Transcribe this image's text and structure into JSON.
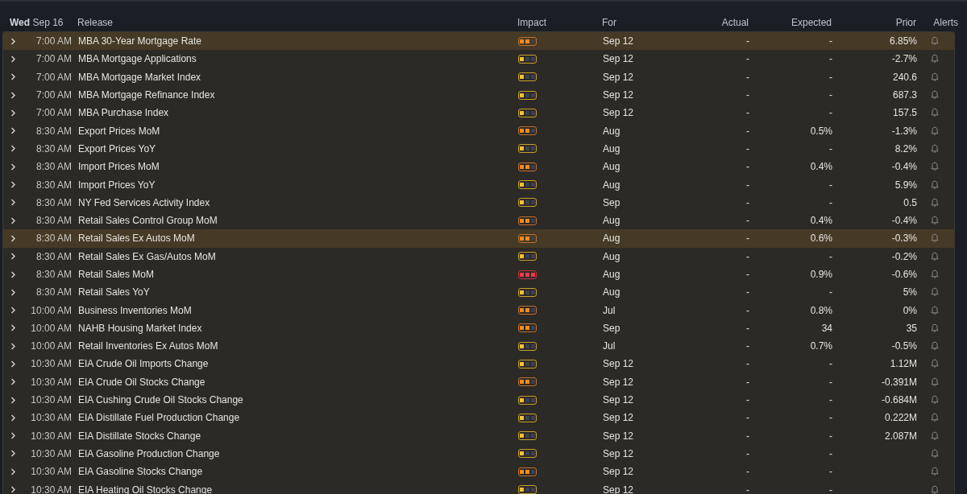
{
  "header": {
    "day": "Wed",
    "date": "Sep 16",
    "columns": [
      "Release",
      "Impact",
      "For",
      "Actual",
      "Expected",
      "Prior",
      "Alerts"
    ]
  },
  "rows": [
    {
      "time": "7:00 AM",
      "release": "MBA 30-Year Mortgage Rate",
      "impact": {
        "level": 0.667
      },
      "for": "Sep 12",
      "actual": "-",
      "expected": "-",
      "prior": "6.85%",
      "highlighted": true
    },
    {
      "time": "7:00 AM",
      "release": "MBA Mortgage Applications",
      "impact": {
        "level": 0.333
      },
      "for": "Sep 12",
      "actual": "-",
      "expected": "-",
      "prior": "-2.7%",
      "highlighted": false
    },
    {
      "time": "7:00 AM",
      "release": "MBA Mortgage Market Index",
      "impact": {
        "level": 0.333
      },
      "for": "Sep 12",
      "actual": "-",
      "expected": "-",
      "prior": "240.6",
      "highlighted": false
    },
    {
      "time": "7:00 AM",
      "release": "MBA Mortgage Refinance Index",
      "impact": {
        "level": 0.333
      },
      "for": "Sep 12",
      "actual": "-",
      "expected": "-",
      "prior": "687.3",
      "highlighted": false
    },
    {
      "time": "7:00 AM",
      "release": "MBA Purchase Index",
      "impact": {
        "level": 0.333
      },
      "for": "Sep 12",
      "actual": "-",
      "expected": "-",
      "prior": "157.5",
      "highlighted": false
    },
    {
      "time": "8:30 AM",
      "release": "Export Prices MoM",
      "impact": {
        "level": 0.667
      },
      "for": "Aug",
      "actual": "-",
      "expected": "0.5%",
      "prior": "-1.3%",
      "highlighted": false
    },
    {
      "time": "8:30 AM",
      "release": "Export Prices YoY",
      "impact": {
        "level": 0.333
      },
      "for": "Aug",
      "actual": "-",
      "expected": "-",
      "prior": "8.2%",
      "highlighted": false
    },
    {
      "time": "8:30 AM",
      "release": "Import Prices MoM",
      "impact": {
        "level": 0.667
      },
      "for": "Aug",
      "actual": "-",
      "expected": "0.4%",
      "prior": "-0.4%",
      "highlighted": false
    },
    {
      "time": "8:30 AM",
      "release": "Import Prices YoY",
      "impact": {
        "level": 0.333
      },
      "for": "Aug",
      "actual": "-",
      "expected": "-",
      "prior": "5.9%",
      "highlighted": false
    },
    {
      "time": "8:30 AM",
      "release": "NY Fed Services Activity Index",
      "impact": {
        "level": 0.333
      },
      "for": "Sep",
      "actual": "-",
      "expected": "-",
      "prior": "0.5",
      "highlighted": false
    },
    {
      "time": "8:30 AM",
      "release": "Retail Sales Control Group MoM",
      "impact": {
        "level": 0.667
      },
      "for": "Aug",
      "actual": "-",
      "expected": "0.4%",
      "prior": "-0.4%",
      "highlighted": false
    },
    {
      "time": "8:30 AM",
      "release": "Retail Sales Ex Autos MoM",
      "impact": {
        "level": 0.667
      },
      "for": "Aug",
      "actual": "-",
      "expected": "0.6%",
      "prior": "-0.3%",
      "highlighted": true
    },
    {
      "time": "8:30 AM",
      "release": "Retail Sales Ex Gas/Autos MoM",
      "impact": {
        "level": 0.333
      },
      "for": "Aug",
      "actual": "-",
      "expected": "-",
      "prior": "-0.2%",
      "highlighted": false
    },
    {
      "time": "8:30 AM",
      "release": "Retail Sales MoM",
      "impact": {
        "level": 1
      },
      "for": "Aug",
      "actual": "-",
      "expected": "0.9%",
      "prior": "-0.6%",
      "highlighted": false
    },
    {
      "time": "8:30 AM",
      "release": "Retail Sales YoY",
      "impact": {
        "level": 0.333
      },
      "for": "Aug",
      "actual": "-",
      "expected": "-",
      "prior": "5%",
      "highlighted": false
    },
    {
      "time": "10:00 AM",
      "release": "Business Inventories MoM",
      "impact": {
        "level": 0.667
      },
      "for": "Jul",
      "actual": "-",
      "expected": "0.8%",
      "prior": "0%",
      "highlighted": false
    },
    {
      "time": "10:00 AM",
      "release": "NAHB Housing Market Index",
      "impact": {
        "level": 0.667
      },
      "for": "Sep",
      "actual": "-",
      "expected": "34",
      "prior": "35",
      "highlighted": false
    },
    {
      "time": "10:00 AM",
      "release": "Retail Inventories Ex Autos MoM",
      "impact": {
        "level": 0.333
      },
      "for": "Jul",
      "actual": "-",
      "expected": "0.7%",
      "prior": "-0.5%",
      "highlighted": false
    },
    {
      "time": "10:30 AM",
      "release": "EIA Crude Oil Imports Change",
      "impact": {
        "level": 0.333
      },
      "for": "Sep 12",
      "actual": "-",
      "expected": "-",
      "prior": "1.12M",
      "highlighted": false
    },
    {
      "time": "10:30 AM",
      "release": "EIA Crude Oil Stocks Change",
      "impact": {
        "level": 0.667
      },
      "for": "Sep 12",
      "actual": "-",
      "expected": "-",
      "prior": "-0.391M",
      "highlighted": false
    },
    {
      "time": "10:30 AM",
      "release": "EIA Cushing Crude Oil Stocks Change",
      "impact": {
        "level": 0.333
      },
      "for": "Sep 12",
      "actual": "-",
      "expected": "-",
      "prior": "-0.684M",
      "highlighted": false
    },
    {
      "time": "10:30 AM",
      "release": "EIA Distillate Fuel Production Change",
      "impact": {
        "level": 0.333
      },
      "for": "Sep 12",
      "actual": "-",
      "expected": "-",
      "prior": "0.222M",
      "highlighted": false
    },
    {
      "time": "10:30 AM",
      "release": "EIA Distillate Stocks Change",
      "impact": {
        "level": 0.333
      },
      "for": "Sep 12",
      "actual": "-",
      "expected": "-",
      "prior": "2.087M",
      "highlighted": false
    },
    {
      "time": "10:30 AM",
      "release": "EIA Gasoline Production Change",
      "impact": {
        "level": 0.333
      },
      "for": "Sep 12",
      "actual": "-",
      "expected": "-",
      "highlighted": false
    },
    {
      "time": "10:30 AM",
      "release": "EIA Gasoline Stocks Change",
      "impact": {
        "level": 0.667
      },
      "for": "Sep 12",
      "actual": "-",
      "expected": "-",
      "highlighted": false
    },
    {
      "time": "10:30 AM",
      "release": "EIA Heating Oil Stocks Change",
      "impact": {
        "level": 0.333
      },
      "for": "Sep 12",
      "actual": "-",
      "expected": "-",
      "highlighted": false
    }
  ]
}
